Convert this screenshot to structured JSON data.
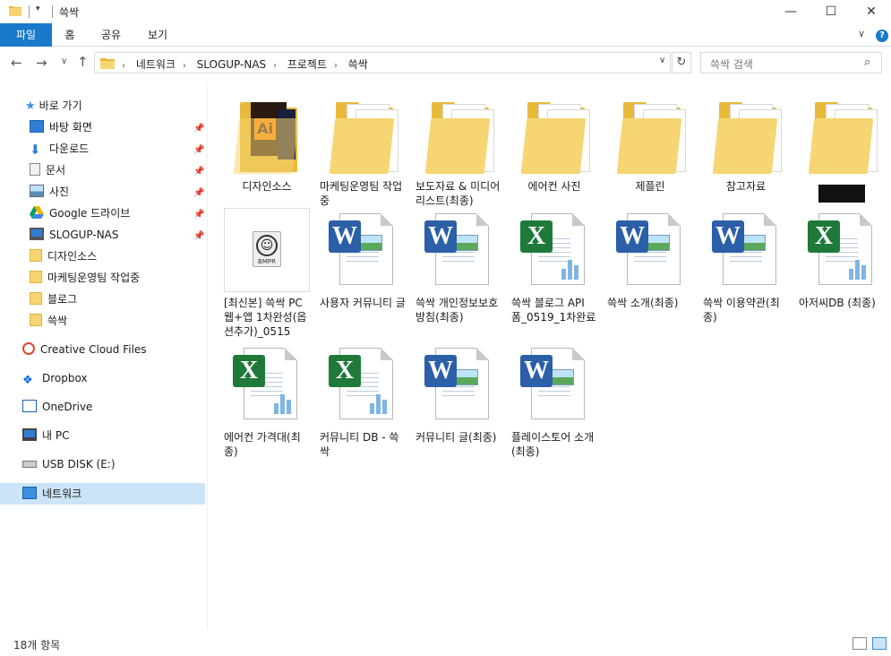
{
  "window": {
    "title": "쓱싹",
    "minimize": "—",
    "maximize": "☐",
    "close": "✕"
  },
  "ribbon": {
    "tabs": [
      "파일",
      "홈",
      "공유",
      "보기"
    ],
    "help": "?"
  },
  "address": {
    "crumbs": [
      "네트워크",
      "SLOGUP-NAS",
      "프로젝트",
      "쓱싹"
    ],
    "separator": "›"
  },
  "search": {
    "placeholder": "쓱싹 검색"
  },
  "navpane": {
    "quick_access": "바로 가기",
    "pinned": [
      {
        "label": "바탕 화면",
        "icon": "desktop-icon"
      },
      {
        "label": "다운로드",
        "icon": "download-icon"
      },
      {
        "label": "문서",
        "icon": "documents-icon"
      },
      {
        "label": "사진",
        "icon": "pictures-icon"
      },
      {
        "label": "Google 드라이브",
        "icon": "google-drive-icon"
      },
      {
        "label": "SLOGUP-NAS",
        "icon": "nas-icon"
      }
    ],
    "recent": [
      "디자인소스",
      "마케팅운영팀 작업중",
      "블로그",
      "쓱싹"
    ],
    "roots": [
      {
        "label": "Creative Cloud Files",
        "icon": "creative-cloud-icon"
      },
      {
        "label": "Dropbox",
        "icon": "dropbox-icon"
      },
      {
        "label": "OneDrive",
        "icon": "onedrive-icon"
      },
      {
        "label": "내 PC",
        "icon": "pc-icon"
      },
      {
        "label": "USB DISK (E:)",
        "icon": "usb-icon"
      },
      {
        "label": "네트워크",
        "icon": "network-icon"
      }
    ]
  },
  "files": [
    {
      "name": "디자인소스",
      "type": "folder-ai"
    },
    {
      "name": "마케팅운영팀 작업중",
      "type": "folder"
    },
    {
      "name": "보도자료 & 미디어리스트(최종)",
      "type": "folder"
    },
    {
      "name": "에어컨 사진",
      "type": "folder"
    },
    {
      "name": "제플린",
      "type": "folder"
    },
    {
      "name": "참고자료",
      "type": "folder"
    },
    {
      "name": "",
      "type": "folder-redacted"
    },
    {
      "name": "[최신본] 쓱싹 PC웹+앱 1차완성(옵션추가)_0515",
      "type": "bmpr"
    },
    {
      "name": "사용자 커뮤니티 글",
      "type": "word"
    },
    {
      "name": "쓱싹 개인정보보호방침(최종)",
      "type": "word"
    },
    {
      "name": "쓱싹 블로그 API 폼_0519_1차완료",
      "type": "excel"
    },
    {
      "name": "쓱싹 소개(최종)",
      "type": "word"
    },
    {
      "name": "쓱싹 이용약관(최종)",
      "type": "word"
    },
    {
      "name": "아저씨DB (최종)",
      "type": "excel"
    },
    {
      "name": "에어컨 가격대(최종)",
      "type": "excel"
    },
    {
      "name": "커뮤니티 DB - 쓱싹",
      "type": "excel"
    },
    {
      "name": "커뮤니티 글(최종)",
      "type": "word"
    },
    {
      "name": "플레이스토어 소개(최종)",
      "type": "word"
    }
  ],
  "status": {
    "count": "18개 항목"
  }
}
